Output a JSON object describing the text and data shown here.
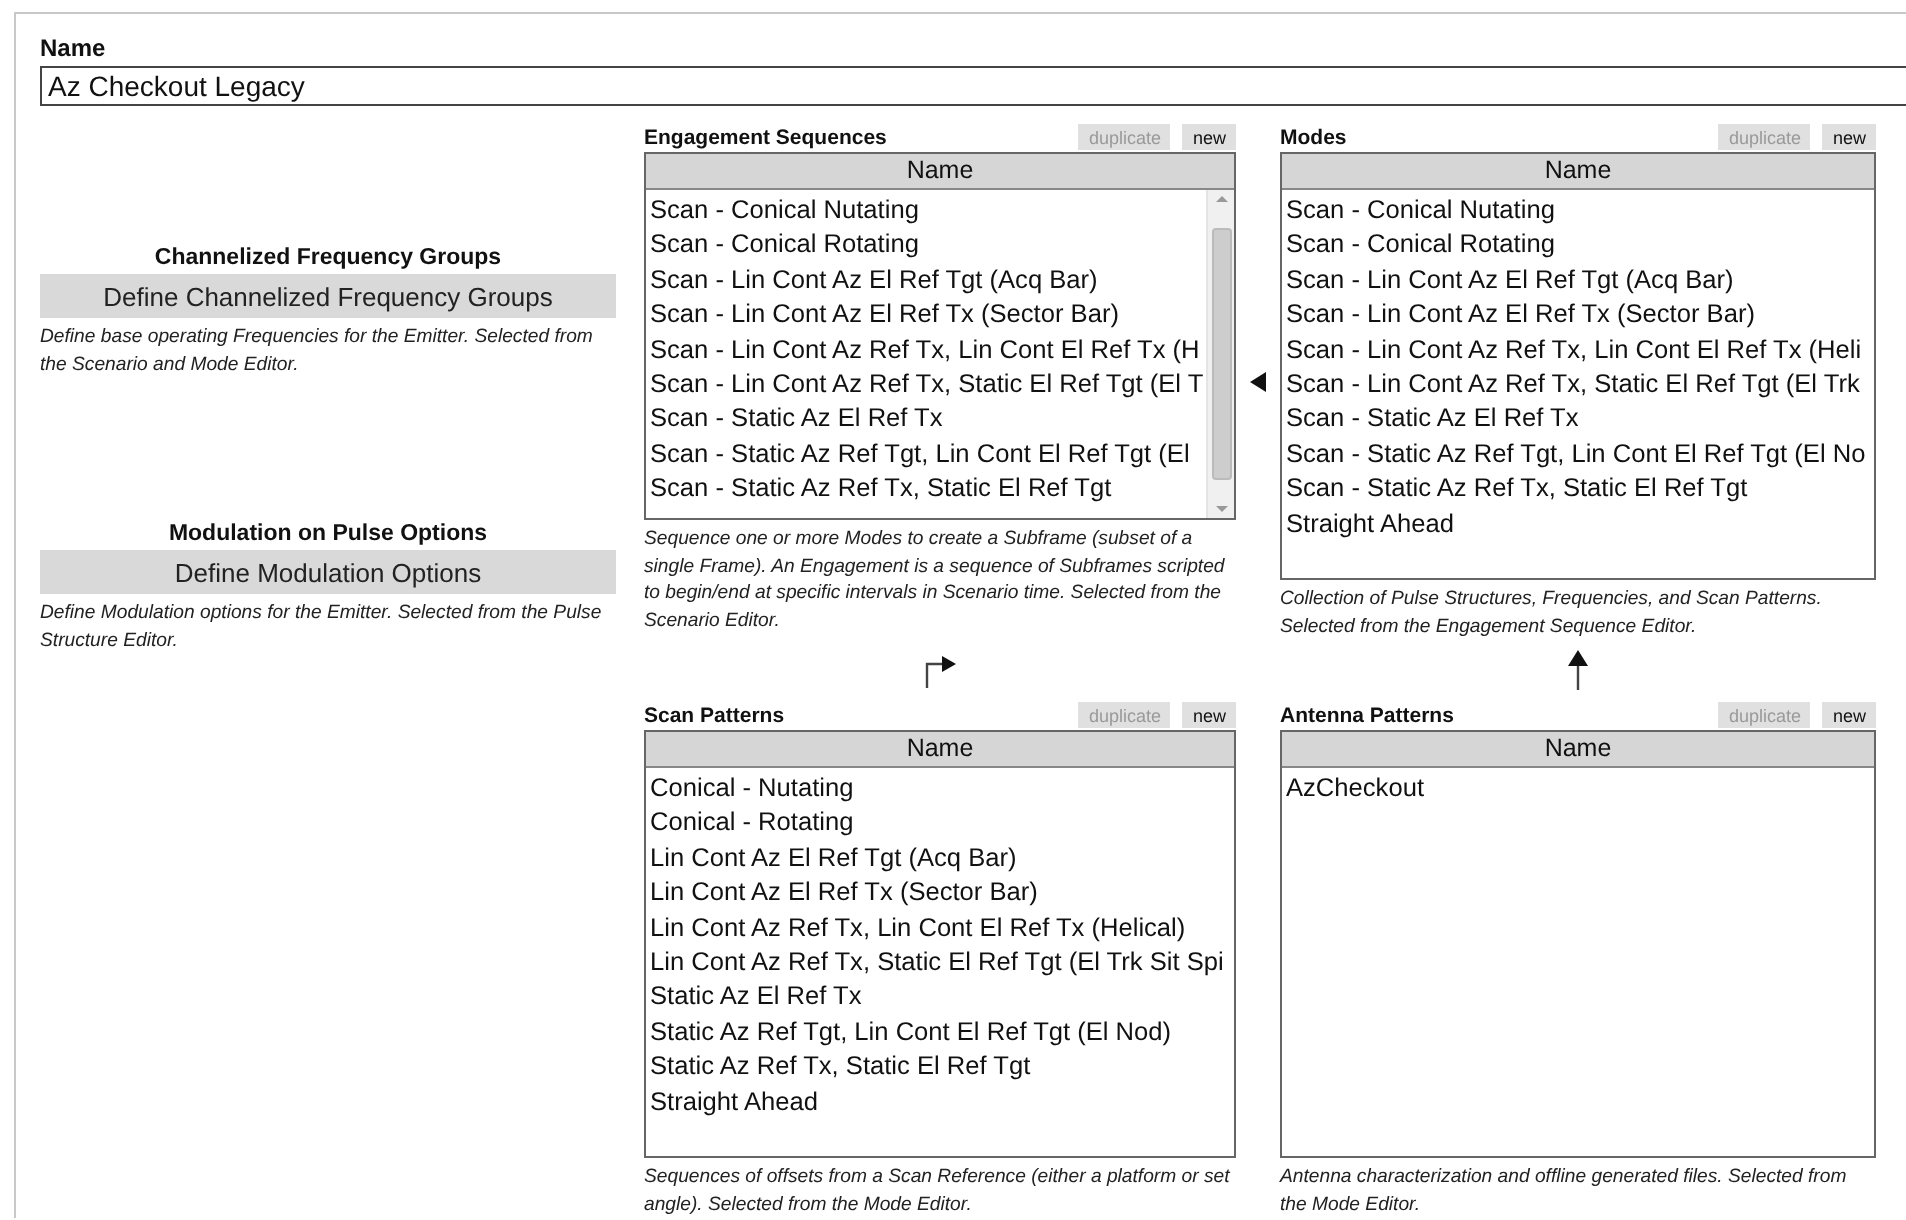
{
  "name_field": {
    "label": "Name",
    "value": "Az Checkout Legacy"
  },
  "option_groups": [
    {
      "title": "Channelized Frequency Groups",
      "button": "Define Channelized Frequency Groups",
      "description": "Define base operating Frequencies for the Emitter. Selected from the Scenario and Mode Editor."
    },
    {
      "title": "Modulation on Pulse Options",
      "button": "Define Modulation Options",
      "description": "Define Modulation options for the Emitter. Selected from the Pulse Structure Editor."
    }
  ],
  "panels": [
    {
      "title": "Engagement Sequences",
      "buttons": [
        {
          "label": "duplicate",
          "disabled": true
        },
        {
          "label": "new",
          "disabled": false
        }
      ],
      "column": "Name",
      "scrollbar": true,
      "rows": [
        "Scan - Conical Nutating",
        "Scan - Conical Rotating",
        "Scan - Lin Cont Az El Ref Tgt (Acq Bar)",
        "Scan - Lin Cont Az El Ref Tx (Sector Bar)",
        "Scan - Lin Cont Az Ref Tx, Lin Cont El Ref Tx (H",
        "Scan - Lin Cont Az Ref Tx, Static El Ref Tgt (El T",
        "Scan - Static Az El Ref Tx",
        "Scan - Static Az Ref Tgt, Lin Cont El Ref Tgt (El",
        "Scan - Static Az Ref Tx, Static El Ref Tgt"
      ],
      "description": "Sequence one or more Modes to create a Subframe (subset of a single Frame). An Engagement is a sequence of Subframes scripted to begin/end at specific intervals in Scenario time. Selected from the Scenario Editor."
    },
    {
      "title": "Modes",
      "buttons": [
        {
          "label": "duplicate",
          "disabled": true
        },
        {
          "label": "new",
          "disabled": false
        }
      ],
      "column": "Name",
      "scrollbar": false,
      "rows": [
        "Scan - Conical Nutating",
        "Scan - Conical Rotating",
        "Scan - Lin Cont Az El Ref Tgt (Acq Bar)",
        "Scan - Lin Cont Az El Ref Tx (Sector Bar)",
        "Scan - Lin Cont Az Ref Tx, Lin Cont El Ref Tx (Heli",
        "Scan - Lin Cont Az Ref Tx, Static El Ref Tgt (El Trk",
        "Scan - Static Az El Ref Tx",
        "Scan - Static Az Ref Tgt, Lin Cont El Ref Tgt (El No",
        "Scan - Static Az Ref Tx, Static El Ref Tgt",
        "Straight Ahead"
      ],
      "description": "Collection of Pulse Structures, Frequencies, and Scan Patterns. Selected from the Engagement Sequence Editor."
    },
    {
      "title": "Scan Patterns",
      "buttons": [
        {
          "label": "duplicate",
          "disabled": true
        },
        {
          "label": "new",
          "disabled": false
        }
      ],
      "column": "Name",
      "scrollbar": false,
      "rows": [
        "Conical - Nutating",
        "Conical - Rotating",
        "Lin Cont Az El Ref Tgt (Acq Bar)",
        "Lin Cont Az El Ref Tx (Sector Bar)",
        "Lin Cont Az Ref Tx, Lin Cont El Ref Tx (Helical)",
        "Lin Cont Az Ref Tx, Static El Ref Tgt (El Trk Sit Spi",
        "Static Az El Ref Tx",
        "Static Az Ref Tgt, Lin Cont El Ref Tgt (El Nod)",
        "Static Az Ref Tx, Static El Ref Tgt",
        "Straight Ahead"
      ],
      "description": "Sequences of offsets from a Scan Reference (either a platform or set angle). Selected from the Mode Editor."
    },
    {
      "title": "Antenna Patterns",
      "buttons": [
        {
          "label": "duplicate",
          "disabled": true
        },
        {
          "label": "new",
          "disabled": false
        }
      ],
      "column": "Name",
      "scrollbar": false,
      "rows": [
        "AzCheckout"
      ],
      "description": "Antenna characterization and offline generated files. Selected from the Mode Editor."
    }
  ]
}
